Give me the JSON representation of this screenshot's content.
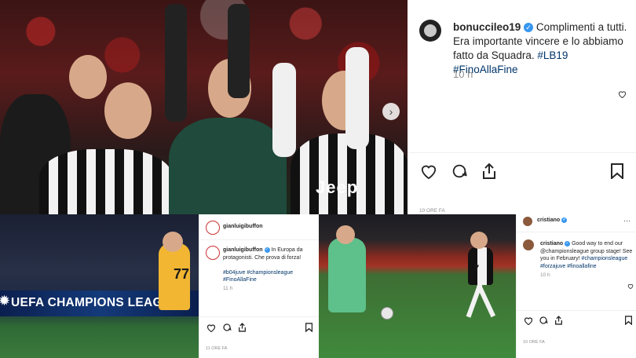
{
  "main_post": {
    "username": "bonucci",
    "username_suffix": "leo19",
    "caption_text": "Complimenti a tutti. Era importante vincere e lo abbiamo fatto da Squadra.",
    "hashtags": "#LB19 #FinoAllaFine",
    "time": "10 h",
    "jersey_sponsor": "Jeep"
  },
  "buffon_post": {
    "header_username": "gianluigibuffon",
    "caption_username": "gianluigibuffon",
    "caption_text": "In Europa da protagonisti. Che prova di forza!",
    "hashtags": "#b04juve #championsleague #FinoAllaFine",
    "time": "11 h",
    "footer_time": "11 ORE FA",
    "jersey_number": "77",
    "banner_text": "UEFA CHAMPIONS LEAGUE"
  },
  "ronaldo_post": {
    "header_username": "cristiano",
    "caption_username": "cristiano",
    "caption_text": "Good way to end our @championsleague group stage! See you in February!",
    "hashtags": "#championsleague #forzajuve #finoallafine",
    "time": "10 h",
    "footer_time": "10 ORE FA",
    "jersey_number": "7"
  },
  "footer_strip_time": "10 ORE FA",
  "colors": {
    "verified": "#3897f0",
    "hashtag": "#003569",
    "secondary_text": "#8e8e8e"
  }
}
